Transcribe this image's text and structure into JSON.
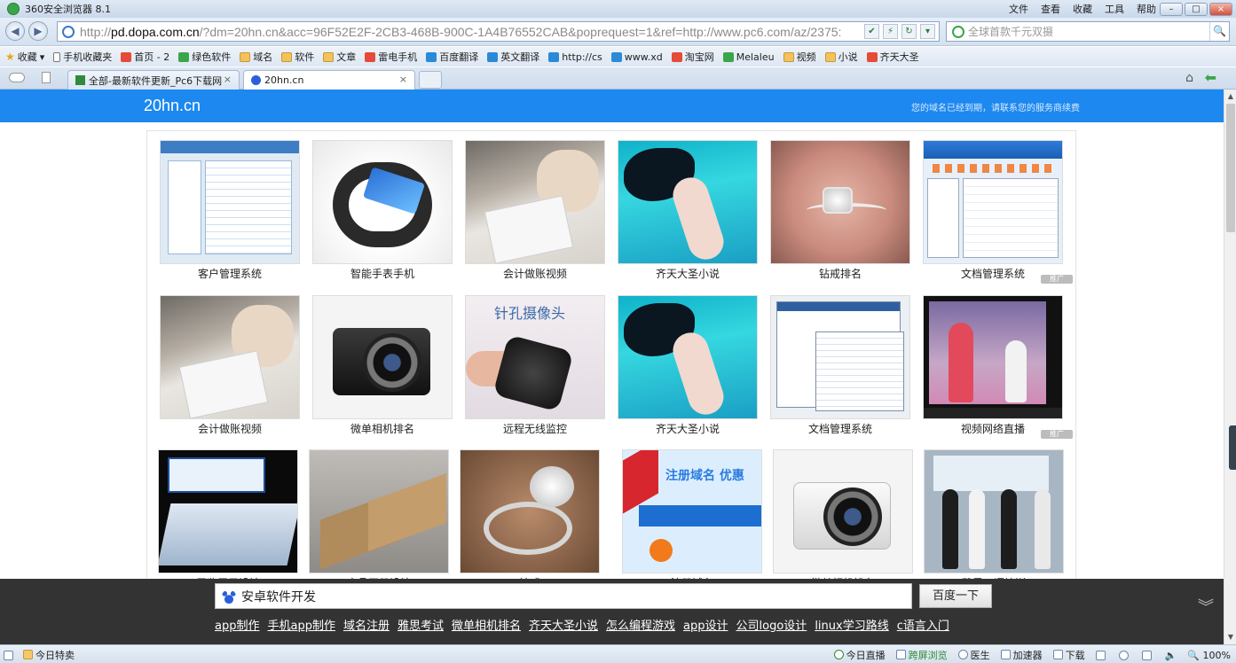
{
  "window": {
    "title": "360安全浏览器 8.1",
    "menu": [
      "文件",
      "查看",
      "收藏",
      "工具",
      "帮助"
    ],
    "controls": [
      "–",
      "□",
      "×"
    ]
  },
  "address_bar": {
    "url_prefix": "http://",
    "url_host": "pd.dopa.com.cn",
    "url_rest": "/?dm=20hn.cn&acc=96F52E2F-2CB3-468B-900C-1A4B76552CAB&poprequest=1&ref=http://www.pc6.com/az/2375:",
    "search_placeholder": "全球首款千元双摄"
  },
  "bookmarks": [
    {
      "label": "收藏",
      "icon": "star-icon"
    },
    {
      "label": "手机收藏夹",
      "icon": "phone-icon"
    },
    {
      "label": "首页 - 2",
      "icon": "site-icon"
    },
    {
      "label": "绿色软件",
      "icon": "site-icon"
    },
    {
      "label": "域名",
      "icon": "folder-icon"
    },
    {
      "label": "软件",
      "icon": "folder-icon"
    },
    {
      "label": "文章",
      "icon": "folder-icon"
    },
    {
      "label": "雷电手机",
      "icon": "site-icon"
    },
    {
      "label": "百度翻译",
      "icon": "site-icon"
    },
    {
      "label": "英文翻译",
      "icon": "site-icon"
    },
    {
      "label": "http://cs",
      "icon": "site-icon"
    },
    {
      "label": "www.xd",
      "icon": "site-icon"
    },
    {
      "label": "淘宝网",
      "icon": "site-icon"
    },
    {
      "label": "Melaleu",
      "icon": "site-icon"
    },
    {
      "label": "视频",
      "icon": "folder-icon"
    },
    {
      "label": "小说",
      "icon": "folder-icon"
    },
    {
      "label": "齐天大圣",
      "icon": "site-icon"
    }
  ],
  "tabs": [
    {
      "label": "全部-最新软件更新_Pc6下载网",
      "close": "×"
    },
    {
      "label": "20hn.cn",
      "close": "×"
    }
  ],
  "page": {
    "domain": "20hn.cn",
    "notice": "您的域名已经到期，请联系您的服务商续费",
    "promo_label": "推广",
    "items": [
      {
        "caption": "客户管理系统",
        "art": "ui"
      },
      {
        "caption": "智能手表手机",
        "art": "watch"
      },
      {
        "caption": "会计做账视频",
        "art": "study"
      },
      {
        "caption": "齐天大圣小说",
        "art": "sea"
      },
      {
        "caption": "钻戒排名",
        "art": "ring"
      },
      {
        "caption": "文档管理系统",
        "art": "doc"
      },
      {
        "caption": "会计做账视频",
        "art": "study"
      },
      {
        "caption": "微单相机排名",
        "art": "camera"
      },
      {
        "caption": "远程无线监控",
        "art": "pinhole"
      },
      {
        "caption": "齐天大圣小说",
        "art": "sea"
      },
      {
        "caption": "文档管理系统",
        "art": "grid"
      },
      {
        "caption": "视频网络直播",
        "art": "video"
      },
      {
        "caption": "展览展示设计",
        "art": "booth"
      },
      {
        "caption": "产品画册设计",
        "art": "book"
      },
      {
        "caption": "钻戒",
        "art": "ring2"
      },
      {
        "caption": "注册域名",
        "art": "domain"
      },
      {
        "caption": "微单相机排名",
        "art": "camera-white"
      },
      {
        "caption": "雅思口语培训",
        "art": "class"
      }
    ],
    "pinhole_title": "针孔摄像头",
    "domain_headline": "注册域名 优惠"
  },
  "search_bar": {
    "query": "安卓软件开发",
    "button": "百度一下",
    "hot_links": [
      "app制作",
      "手机app制作",
      "域名注册",
      "雅思考试",
      "微单相机排名",
      "齐天大圣小说",
      "怎么编程游戏",
      "app设计",
      "公司logo设计",
      "linux学习路线",
      "c语言入门"
    ]
  },
  "status_bar": {
    "left_label": "今日特卖",
    "items": [
      "今日直播",
      "跨屏浏览",
      "医生",
      "加速器",
      "下载"
    ],
    "zoom": "100%"
  }
}
